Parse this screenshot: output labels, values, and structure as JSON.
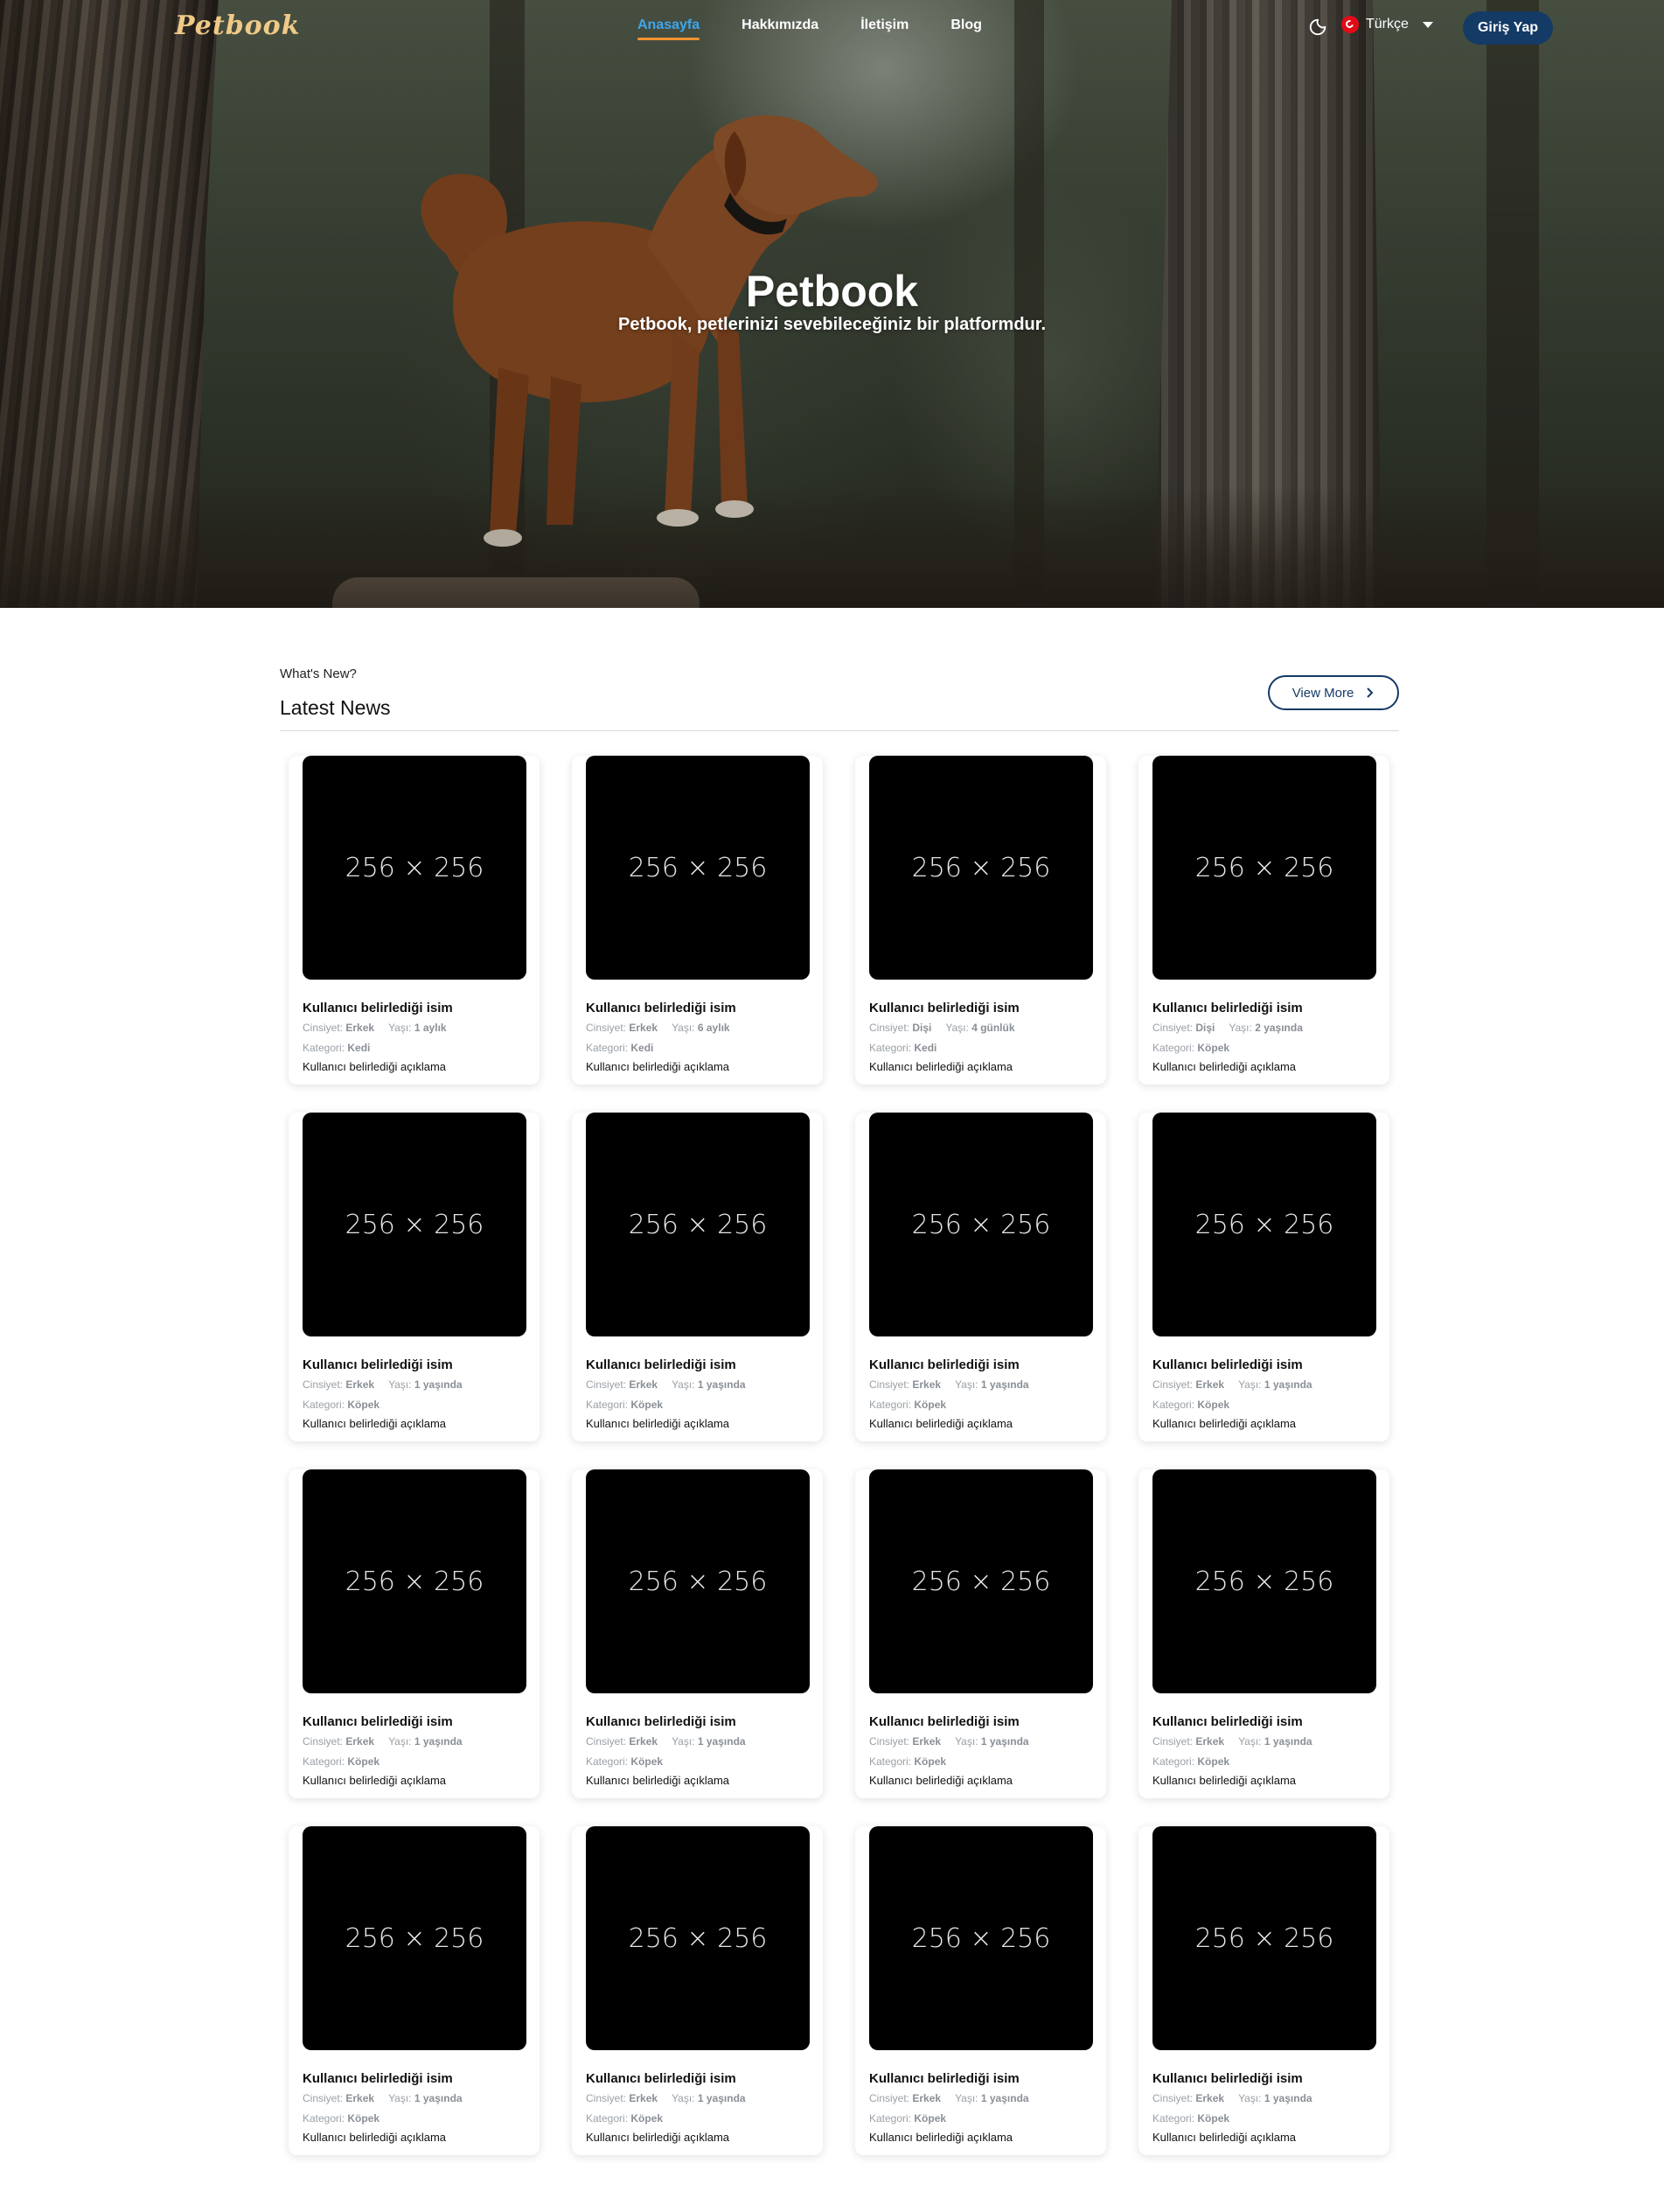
{
  "brand": {
    "logo": "Petbook"
  },
  "nav": {
    "links": [
      "Anasayfa",
      "Hakkımızda",
      "İletişim",
      "Blog"
    ],
    "active_index": 0,
    "language": "Türkçe",
    "login_label": "Giriş Yap"
  },
  "hero": {
    "title": "Petbook",
    "subtitle": "Petbook, petlerinizi sevebileceğiniz bir platformdur."
  },
  "news": {
    "kicker": "What's New?",
    "title": "Latest News",
    "view_more": "View More",
    "labels": {
      "gender": "Cinsiyet:",
      "age": "Yaşı:",
      "category": "Kategori:"
    },
    "cards": [
      {
        "image": "256 × 256",
        "name": "Kullanıcı belirlediği isim",
        "gender": "Erkek",
        "age": "1 aylık",
        "category": "Kedi",
        "desc": "Kullanıcı belirlediği açıklama"
      },
      {
        "image": "256 × 256",
        "name": "Kullanıcı belirlediği isim",
        "gender": "Erkek",
        "age": "6 aylık",
        "category": "Kedi",
        "desc": "Kullanıcı belirlediği açıklama"
      },
      {
        "image": "256 × 256",
        "name": "Kullanıcı belirlediği isim",
        "gender": "Dişi",
        "age": "4 günlük",
        "category": "Kedi",
        "desc": "Kullanıcı belirlediği açıklama"
      },
      {
        "image": "256 × 256",
        "name": "Kullanıcı belirlediği isim",
        "gender": "Dişi",
        "age": "2 yaşında",
        "category": "Köpek",
        "desc": "Kullanıcı belirlediği açıklama"
      },
      {
        "image": "256 × 256",
        "name": "Kullanıcı belirlediği isim",
        "gender": "Erkek",
        "age": "1 yaşında",
        "category": "Köpek",
        "desc": "Kullanıcı belirlediği açıklama"
      },
      {
        "image": "256 × 256",
        "name": "Kullanıcı belirlediği isim",
        "gender": "Erkek",
        "age": "1 yaşında",
        "category": "Köpek",
        "desc": "Kullanıcı belirlediği açıklama"
      },
      {
        "image": "256 × 256",
        "name": "Kullanıcı belirlediği isim",
        "gender": "Erkek",
        "age": "1 yaşında",
        "category": "Köpek",
        "desc": "Kullanıcı belirlediği açıklama"
      },
      {
        "image": "256 × 256",
        "name": "Kullanıcı belirlediği isim",
        "gender": "Erkek",
        "age": "1 yaşında",
        "category": "Köpek",
        "desc": "Kullanıcı belirlediği açıklama"
      },
      {
        "image": "256 × 256",
        "name": "Kullanıcı belirlediği isim",
        "gender": "Erkek",
        "age": "1 yaşında",
        "category": "Köpek",
        "desc": "Kullanıcı belirlediği açıklama"
      },
      {
        "image": "256 × 256",
        "name": "Kullanıcı belirlediği isim",
        "gender": "Erkek",
        "age": "1 yaşında",
        "category": "Köpek",
        "desc": "Kullanıcı belirlediği açıklama"
      },
      {
        "image": "256 × 256",
        "name": "Kullanıcı belirlediği isim",
        "gender": "Erkek",
        "age": "1 yaşında",
        "category": "Köpek",
        "desc": "Kullanıcı belirlediği açıklama"
      },
      {
        "image": "256 × 256",
        "name": "Kullanıcı belirlediği isim",
        "gender": "Erkek",
        "age": "1 yaşında",
        "category": "Köpek",
        "desc": "Kullanıcı belirlediği açıklama"
      },
      {
        "image": "256 × 256",
        "name": "Kullanıcı belirlediği isim",
        "gender": "Erkek",
        "age": "1 yaşında",
        "category": "Köpek",
        "desc": "Kullanıcı belirlediği açıklama"
      },
      {
        "image": "256 × 256",
        "name": "Kullanıcı belirlediği isim",
        "gender": "Erkek",
        "age": "1 yaşında",
        "category": "Köpek",
        "desc": "Kullanıcı belirlediği açıklama"
      },
      {
        "image": "256 × 256",
        "name": "Kullanıcı belirlediği isim",
        "gender": "Erkek",
        "age": "1 yaşında",
        "category": "Köpek",
        "desc": "Kullanıcı belirlediği açıklama"
      },
      {
        "image": "256 × 256",
        "name": "Kullanıcı belirlediği isim",
        "gender": "Erkek",
        "age": "1 yaşında",
        "category": "Köpek",
        "desc": "Kullanıcı belirlediği açıklama"
      }
    ]
  },
  "icons": {
    "theme": "moon-icon",
    "language_flag": "turkey-flag-icon",
    "dropdown": "caret-down-icon",
    "view_more": "chevron-right-icon"
  },
  "colors": {
    "accent": "#3ea6ee",
    "underline": "#f59331",
    "primary": "#143a66",
    "logo": "#f0c987"
  }
}
